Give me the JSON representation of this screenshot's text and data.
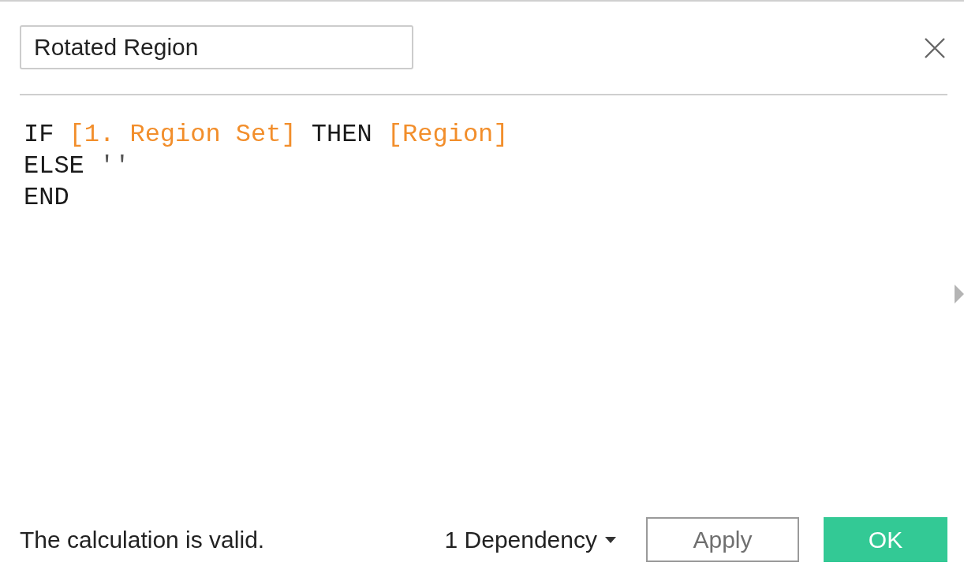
{
  "name_field": {
    "value": "Rotated Region"
  },
  "formula": {
    "lines": [
      [
        {
          "kind": "keyword",
          "text": "IF"
        },
        {
          "kind": "field",
          "text": "[1. Region Set]"
        },
        {
          "kind": "keyword",
          "text": "THEN"
        },
        {
          "kind": "field",
          "text": "[Region]"
        }
      ],
      [
        {
          "kind": "keyword",
          "text": "ELSE"
        },
        {
          "kind": "string",
          "text": "''"
        }
      ],
      [
        {
          "kind": "keyword",
          "text": "END"
        }
      ]
    ]
  },
  "status": "The calculation is valid.",
  "dependencies": {
    "label": "1 Dependency"
  },
  "buttons": [
    {
      "kind": "secondary",
      "label": "Apply"
    },
    {
      "kind": "primary",
      "label": "OK"
    }
  ]
}
